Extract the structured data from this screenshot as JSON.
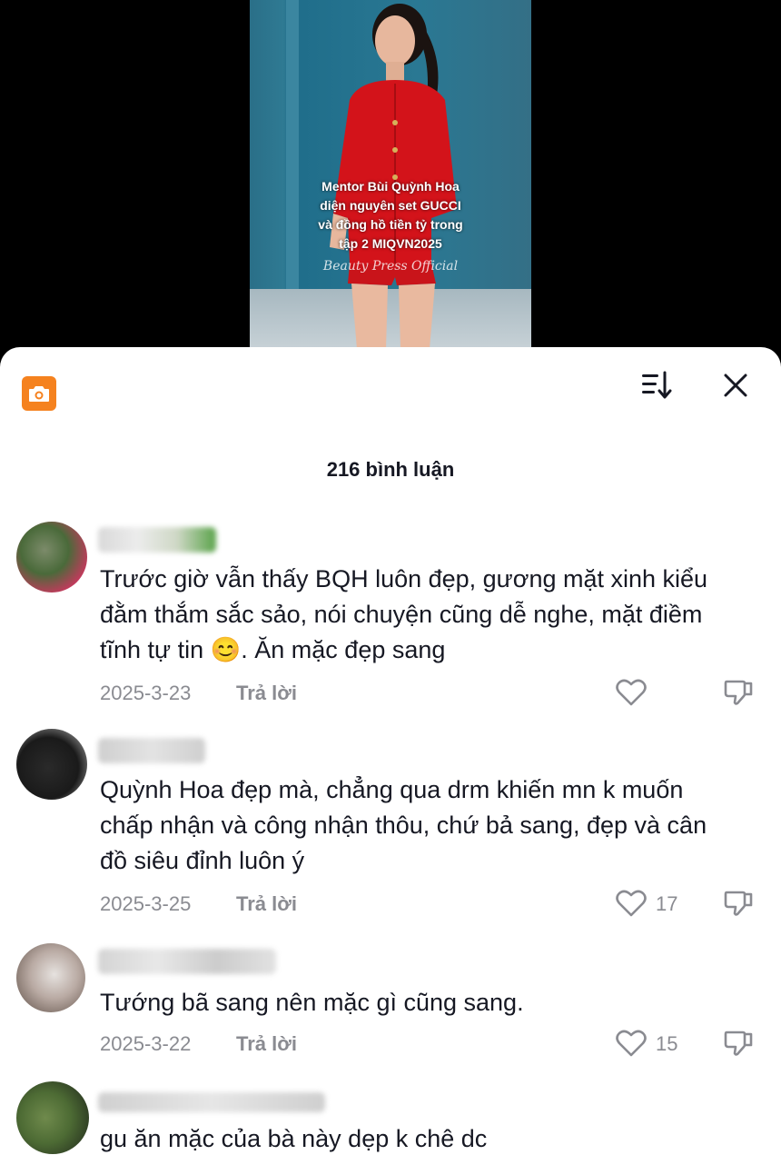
{
  "video": {
    "caption_lines": [
      "Mentor Bùi Quỳnh Hoa",
      "diện nguyên set GUCCI",
      "và đồng hồ tiền tỷ trong",
      "tập 2 MIQVN2025"
    ],
    "watermark": "Beauty Press Official"
  },
  "sheet": {
    "comment_count_label": "216 bình luận",
    "camera_icon": "camera-icon",
    "sort_icon": "sort-icon",
    "close_icon": "close-icon",
    "accent_color": "#f5821f"
  },
  "comments": [
    {
      "text_before_emoji": "Trước giờ vẫn thấy BQH luôn đẹp, gương mặt xinh kiểu đằm thắm sắc sảo, nói chuyện cũng dễ nghe, mặt điềm tĩnh tự tin ",
      "emoji": "😊",
      "text_after_emoji": ". Ăn mặc đẹp sang",
      "date": "2025-3-23",
      "reply_label": "Trả lời",
      "likes": ""
    },
    {
      "text": "Quỳnh Hoa đẹp mà, chẳng qua drm khiến mn k muốn chấp nhận và công nhận thôu, chứ bả sang, đẹp và cân đồ siêu đỉnh luôn ý",
      "date": "2025-3-25",
      "reply_label": "Trả lời",
      "likes": "17"
    },
    {
      "text": "Tướng bã sang nên mặc gì cũng sang.",
      "date": "2025-3-22",
      "reply_label": "Trả lời",
      "likes": "15"
    },
    {
      "text": "gu ăn mặc của bà này dẹp k chê dc"
    }
  ]
}
